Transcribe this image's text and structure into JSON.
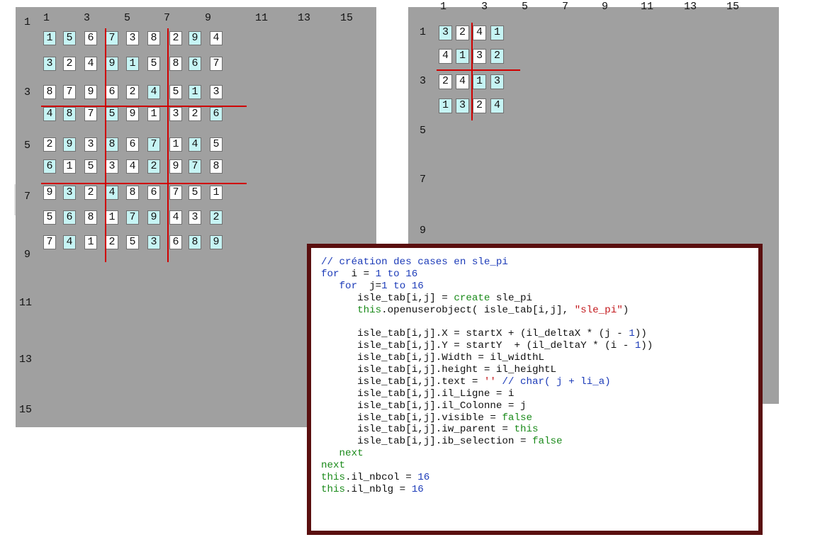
{
  "left_panel": {
    "col_labels": [
      "1",
      "3",
      "5",
      "7",
      "9",
      "11",
      "13",
      "15"
    ],
    "row_labels": [
      "1",
      "3",
      "5",
      "7",
      "9",
      "11",
      "13",
      "15"
    ],
    "grid": [
      [
        "1",
        "5",
        "6",
        "7",
        "3",
        "8",
        "2",
        "9",
        "4"
      ],
      [
        "3",
        "2",
        "4",
        "9",
        "1",
        "5",
        "8",
        "6",
        "7"
      ],
      [
        "8",
        "7",
        "9",
        "6",
        "2",
        "4",
        "5",
        "1",
        "3"
      ],
      [
        "4",
        "8",
        "7",
        "5",
        "9",
        "1",
        "3",
        "2",
        "6"
      ],
      [
        "2",
        "9",
        "3",
        "8",
        "6",
        "7",
        "1",
        "4",
        "5"
      ],
      [
        "6",
        "1",
        "5",
        "3",
        "4",
        "2",
        "9",
        "7",
        "8"
      ],
      [
        "9",
        "3",
        "2",
        "4",
        "8",
        "6",
        "7",
        "5",
        "1"
      ],
      [
        "5",
        "6",
        "8",
        "1",
        "7",
        "9",
        "4",
        "3",
        "2"
      ],
      [
        "7",
        "4",
        "1",
        "2",
        "5",
        "3",
        "6",
        "8",
        "9"
      ]
    ],
    "highlight": [
      [
        1,
        1,
        0,
        1,
        0,
        0,
        0,
        1,
        0
      ],
      [
        1,
        0,
        0,
        1,
        1,
        0,
        0,
        1,
        0
      ],
      [
        0,
        0,
        0,
        0,
        0,
        1,
        0,
        1,
        0
      ],
      [
        1,
        1,
        0,
        1,
        0,
        0,
        0,
        0,
        1
      ],
      [
        0,
        1,
        0,
        1,
        0,
        1,
        0,
        1,
        0
      ],
      [
        1,
        0,
        0,
        0,
        0,
        1,
        0,
        1,
        0
      ],
      [
        0,
        1,
        0,
        1,
        0,
        0,
        0,
        0,
        0
      ],
      [
        0,
        1,
        0,
        0,
        1,
        1,
        0,
        0,
        1
      ],
      [
        0,
        1,
        0,
        0,
        0,
        1,
        0,
        1,
        1
      ]
    ]
  },
  "right_panel": {
    "col_labels": [
      "1",
      "3",
      "5",
      "7",
      "9",
      "11",
      "13",
      "15"
    ],
    "row_labels": [
      "1",
      "3",
      "5",
      "7",
      "9"
    ],
    "grid": [
      [
        "3",
        "2",
        "4",
        "1"
      ],
      [
        "4",
        "1",
        "3",
        "2"
      ],
      [
        "2",
        "4",
        "1",
        "3"
      ],
      [
        "1",
        "3",
        "2",
        "4"
      ]
    ],
    "highlight": [
      [
        1,
        0,
        0,
        1
      ],
      [
        0,
        1,
        0,
        1
      ],
      [
        0,
        0,
        1,
        1
      ],
      [
        1,
        1,
        0,
        1
      ]
    ]
  },
  "colors": {
    "panel_bg": "#a0a0a0",
    "highlight_cell": "#c6f4f4",
    "block_separator": "#d00000",
    "code_border": "#5a0f0f"
  },
  "code": {
    "lines": [
      [
        [
          "c-cmt",
          "// création des cases en sle_pi"
        ]
      ],
      [
        [
          "c-kw",
          "for"
        ],
        [
          "",
          "  i = "
        ],
        [
          "c-num",
          "1"
        ],
        [
          "c-kw",
          " to "
        ],
        [
          "c-num",
          "16"
        ]
      ],
      [
        [
          "",
          "   "
        ],
        [
          "c-kw",
          "for"
        ],
        [
          "",
          "  j="
        ],
        [
          "c-num",
          "1"
        ],
        [
          "c-kw",
          " to "
        ],
        [
          "c-num",
          "16"
        ]
      ],
      [
        [
          "",
          "      isle_tab[i,j] = "
        ],
        [
          "c-fn",
          "create"
        ],
        [
          "",
          " sle_pi"
        ]
      ],
      [
        [
          "",
          "      "
        ],
        [
          "c-fn",
          "this"
        ],
        [
          "",
          ".openuserobject( isle_tab[i,j], "
        ],
        [
          "c-str",
          "\"sle_pi\""
        ],
        [
          "",
          ")"
        ]
      ],
      [
        [
          "",
          ""
        ]
      ],
      [
        [
          "",
          "      isle_tab[i,j].X = startX + (il_deltaX * (j - "
        ],
        [
          "c-num",
          "1"
        ],
        [
          "",
          "))"
        ]
      ],
      [
        [
          "",
          "      isle_tab[i,j].Y = startY  + (il_deltaY * (i - "
        ],
        [
          "c-num",
          "1"
        ],
        [
          "",
          "))"
        ]
      ],
      [
        [
          "",
          "      isle_tab[i,j].Width = il_widthL"
        ]
      ],
      [
        [
          "",
          "      isle_tab[i,j].height = il_heightL"
        ]
      ],
      [
        [
          "",
          "      isle_tab[i,j].text = "
        ],
        [
          "c-str",
          "''"
        ],
        [
          "c-cmt",
          " // char( j + li_a)"
        ]
      ],
      [
        [
          "",
          "      isle_tab[i,j].il_Ligne = i"
        ]
      ],
      [
        [
          "",
          "      isle_tab[i,j].il_Colonne = j"
        ]
      ],
      [
        [
          "",
          "      isle_tab[i,j].visible = "
        ],
        [
          "c-fn",
          "false"
        ]
      ],
      [
        [
          "",
          "      isle_tab[i,j].iw_parent = "
        ],
        [
          "c-fn",
          "this"
        ]
      ],
      [
        [
          "",
          "      isle_tab[i,j].ib_selection = "
        ],
        [
          "c-fn",
          "false"
        ]
      ],
      [
        [
          "",
          "   "
        ],
        [
          "c-fn",
          "next"
        ]
      ],
      [
        [
          "c-fn",
          "next"
        ]
      ],
      [
        [
          "c-fn",
          "this"
        ],
        [
          "",
          ".il_nbcol = "
        ],
        [
          "c-num",
          "16"
        ]
      ],
      [
        [
          "c-fn",
          "this"
        ],
        [
          "",
          ".il_nblg = "
        ],
        [
          "c-num",
          "16"
        ]
      ]
    ]
  }
}
